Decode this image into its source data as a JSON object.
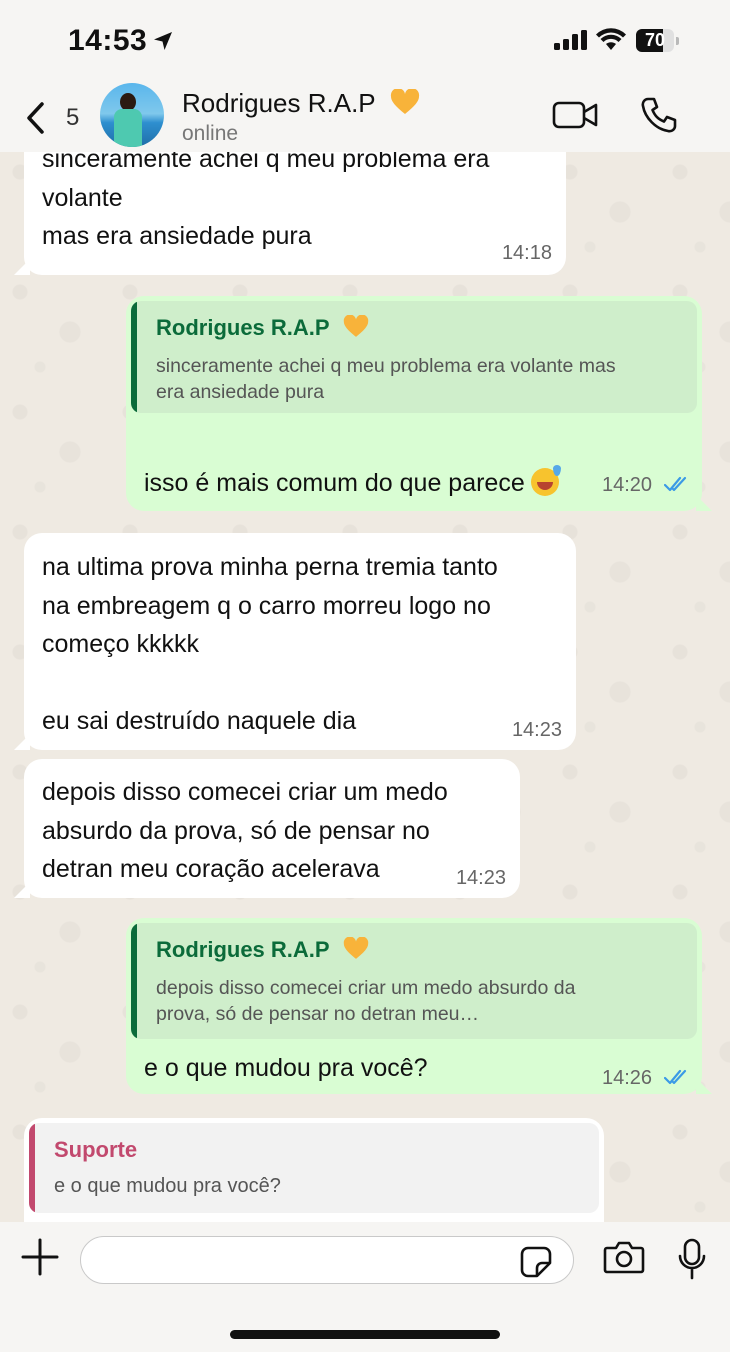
{
  "status_bar": {
    "time": "14:53",
    "battery_level": "70",
    "battery_fraction": 0.7
  },
  "header": {
    "back_count": "5",
    "contact_name": "Rodrigues R.A.P",
    "contact_status": "online",
    "heart_color": "#f8b33a"
  },
  "messages": [
    {
      "direction": "incoming",
      "text": "sinceramente achei q meu problema era\nvolante\nmas era ansiedade pura",
      "time": "14:18"
    },
    {
      "direction": "outgoing",
      "quote_name": "Rodrigues R.A.P",
      "quote_text": "sinceramente achei q meu problema era volante mas\nera ansiedade pura",
      "text": "isso é mais comum do que parece",
      "time": "14:20",
      "status": "read"
    },
    {
      "direction": "incoming",
      "text": "na ultima prova minha perna tremia tanto\nna embreagem q o carro morreu logo no\ncomeço kkkkk\n\neu sai destruído naquele dia",
      "time": "14:23"
    },
    {
      "direction": "incoming",
      "text": "depois disso comecei criar um medo\nabsurdo da prova, só de pensar no\ndetran meu coração acelerava",
      "time": "14:23"
    },
    {
      "direction": "outgoing",
      "quote_name": "Rodrigues R.A.P",
      "quote_text": "depois disso comecei criar um medo absurdo da\nprova, só de pensar no detran meu…",
      "text": "e o que mudou pra você?",
      "time": "14:26",
      "status": "read"
    },
    {
      "direction": "incoming",
      "quote_name": "Suporte",
      "quote_text": "e o que mudou pra você?"
    }
  ],
  "input": {
    "value": ""
  },
  "colors": {
    "outgoing_bubble": "#d9fdd3",
    "incoming_bubble": "#ffffff",
    "quote_accent": "#0b6b3a",
    "support_accent": "#c2496e",
    "read_ticks": "#3b9ae6"
  }
}
